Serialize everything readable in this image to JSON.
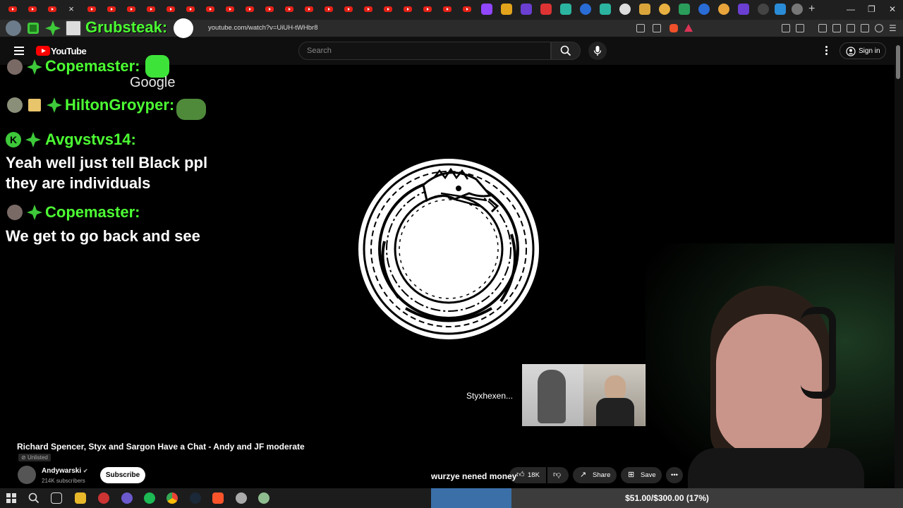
{
  "browser": {
    "url": "youtube.com/watch?v=UiUH-tWHbr8",
    "new_tab": "+",
    "close_tab": "×"
  },
  "youtube": {
    "logo": "YouTube",
    "search_placeholder": "Search",
    "sign_in": "Sign in"
  },
  "chat": {
    "header_user": "Grubsteak:",
    "messages": [
      {
        "user": "Copemaster:",
        "text": "",
        "emote_text": "Google"
      },
      {
        "user": "HiltonGroyper:",
        "text": ""
      },
      {
        "user": "Avgvstvs14:",
        "text": "Yeah well just tell Black ppl they are individuals"
      },
      {
        "user": "Copemaster:",
        "text": "We get to go back and see"
      }
    ]
  },
  "video": {
    "title": "Richard Spencer, Styx and Sargon Have a Chat - Andy and JF moderate",
    "visibility": "Unlisted",
    "channel": "Andywarski",
    "subscribers": "214K subscribers",
    "subscribe": "Subscribe",
    "likes": "18K",
    "share": "Share",
    "save": "Save",
    "participant_label": "Styxhexen...",
    "caption": "wurzye nened money"
  },
  "goal": {
    "text": "$51.00/$300.00 (17%)",
    "fraction": 0.17
  },
  "colors": {
    "chat_name": "#4cff33",
    "youtube_red": "#ff0000",
    "goal_fill": "#3a6fa8"
  }
}
